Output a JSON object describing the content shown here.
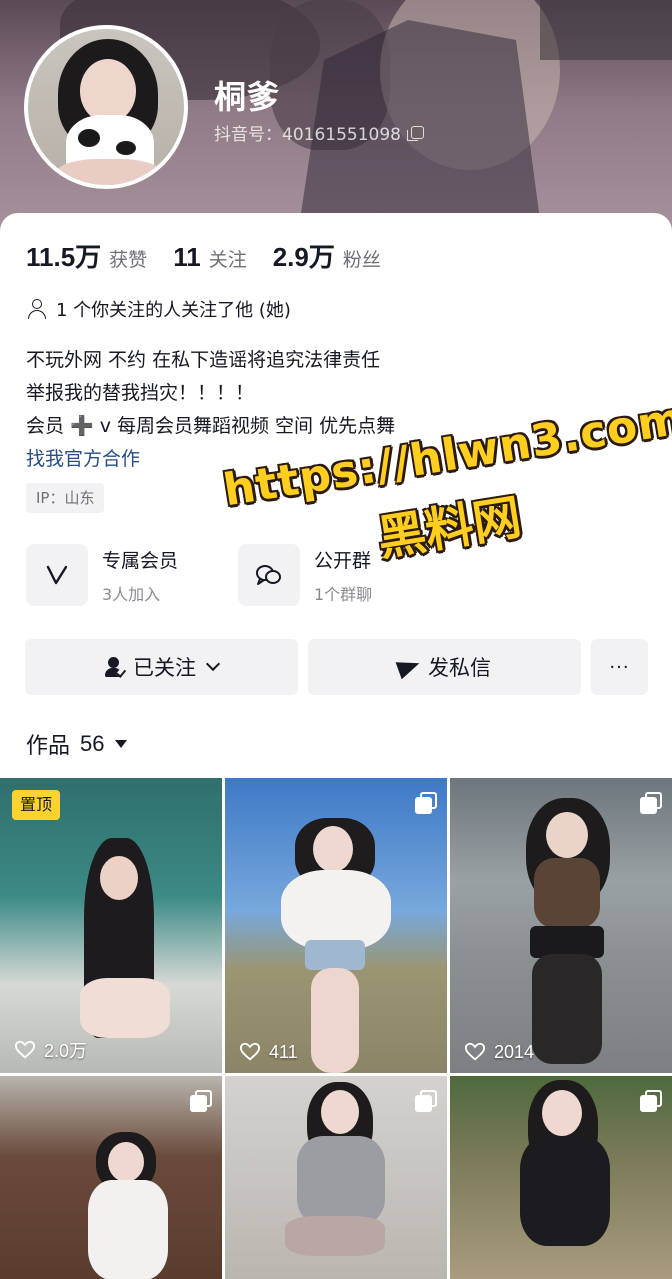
{
  "profile": {
    "name": "桐爹",
    "douyin_id": "抖音号：40161551098"
  },
  "stats": [
    {
      "value": "11.5万",
      "label": "获赞"
    },
    {
      "value": "11",
      "label": "关注"
    },
    {
      "value": "2.9万",
      "label": "粉丝"
    }
  ],
  "mutual_follow": "1 个你关注的人关注了他 (她)",
  "bio": {
    "lines": [
      "不玩外网 不约 在私下造谣将追究法律责任",
      "举报我的替我挡灾！！！！",
      "会员 ➕ v 每周会员舞蹈视频 空间 优先点舞"
    ],
    "link": "找我官方合作"
  },
  "ip_location": "IP：山东",
  "features": [
    {
      "icon": "member-icon",
      "title": "专属会员",
      "subtitle": "3人加入"
    },
    {
      "icon": "group-chat-icon",
      "title": "公开群",
      "subtitle": "1个群聊"
    }
  ],
  "actions": {
    "follow_label": "已关注",
    "message_label": "发私信",
    "more_label": "···"
  },
  "works": {
    "label": "作品",
    "count": "56"
  },
  "grid": [
    {
      "pinned": true,
      "pin_label": "置顶",
      "likes": "2.0万",
      "multi": false
    },
    {
      "pinned": false,
      "likes": "411",
      "multi": true
    },
    {
      "pinned": false,
      "likes": "2014",
      "multi": true
    },
    {
      "pinned": false,
      "multi": true
    },
    {
      "pinned": false,
      "multi": true
    },
    {
      "pinned": false,
      "multi": true
    }
  ],
  "watermark": {
    "url": "https://hlwn3.com",
    "name": "黑料网"
  },
  "colors": {
    "accent_link": "#2a4d85",
    "pin_badge": "#fcd22e",
    "watermark": "#ffce1f"
  }
}
